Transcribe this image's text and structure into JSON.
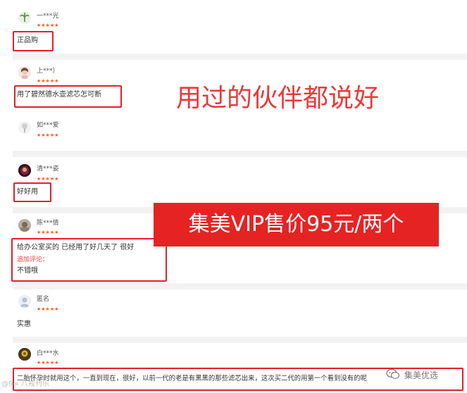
{
  "reviews": [
    {
      "user": "一***光",
      "stars": "★★★★★",
      "text": "正品购"
    },
    {
      "user": "上***）",
      "stars": "★★★★★",
      "text": "用了碧然德水壶滤芯怎可断"
    },
    {
      "user": "如***爱",
      "stars": "★★★★★",
      "text": ""
    },
    {
      "user": "清***姿",
      "stars": "★★★★★",
      "text": "好好用"
    },
    {
      "user": "陈***倩",
      "stars": "★★★★★",
      "text": "给办公室买的 已经用了好几天了 很好",
      "followup_label": "追加评论：",
      "followup_text": "不错哦"
    },
    {
      "user": "匿名",
      "stars": "★★★★★",
      "text": "实惠"
    },
    {
      "user": "白***水",
      "stars": "★★★★★",
      "text": "二胎怀孕时就用这个，一直到现在，很好，以前一代的老是有黑黑的那些滤芯出来，这次买二代的用第一个看到没有的呢"
    }
  ],
  "overlay": {
    "headline": "用过的伙伴都说好",
    "price_banner": "集美VIP售价95元/两个"
  },
  "watermark": {
    "left": "@9∞ 八戒刊乐",
    "right": "集美优选"
  },
  "colors": {
    "accent_red": "#e0212c",
    "star_orange": "#ff5b1f"
  }
}
